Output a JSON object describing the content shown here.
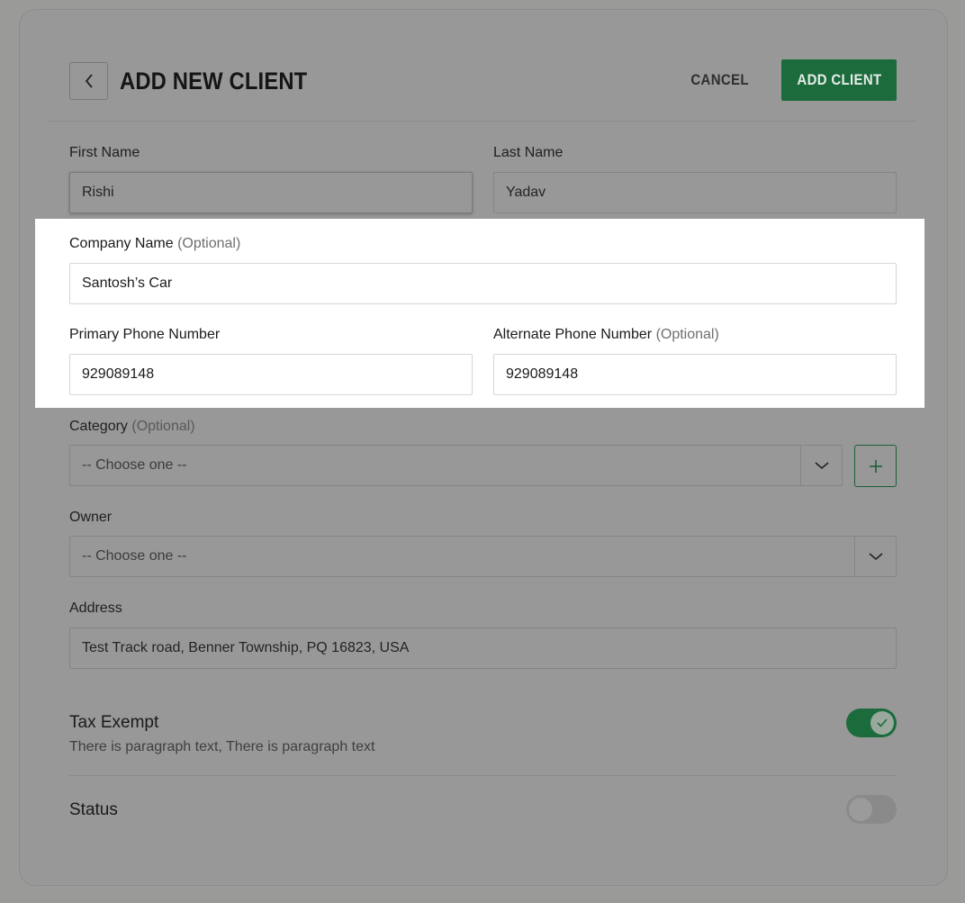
{
  "header": {
    "title": "ADD NEW CLIENT",
    "cancel_label": "CANCEL",
    "add_label": "ADD CLIENT"
  },
  "form": {
    "first_name": {
      "label": "First Name",
      "value": "Rishi"
    },
    "last_name": {
      "label": "Last Name",
      "value": "Yadav"
    },
    "company_name": {
      "label": "Company Name",
      "optional": "(Optional)",
      "value": "Santosh’s Car"
    },
    "primary_phone": {
      "label": "Primary Phone Number",
      "value": "929089148"
    },
    "alternate_phone": {
      "label": "Alternate Phone Number",
      "optional": "(Optional)",
      "value": "929089148"
    },
    "category": {
      "label": "Category",
      "optional": "(Optional)",
      "placeholder": "-- Choose one --"
    },
    "owner": {
      "label": "Owner",
      "placeholder": "-- Choose one --"
    },
    "address": {
      "label": "Address",
      "value": "Test Track road, Benner Township, PQ 16823, USA"
    }
  },
  "tax_exempt": {
    "title": "Tax Exempt",
    "description": "There is paragraph text, There is paragraph text",
    "enabled": true
  },
  "status": {
    "title": "Status",
    "enabled": false
  },
  "colors": {
    "accent": "#1b6b3c",
    "overlay_background": "#9a9a99",
    "highlight_background": "#ffffff"
  },
  "icons": {
    "back": "chevron-left-icon",
    "dropdown": "chevron-down-icon",
    "add": "plus-icon",
    "toggle_check": "check-icon"
  }
}
